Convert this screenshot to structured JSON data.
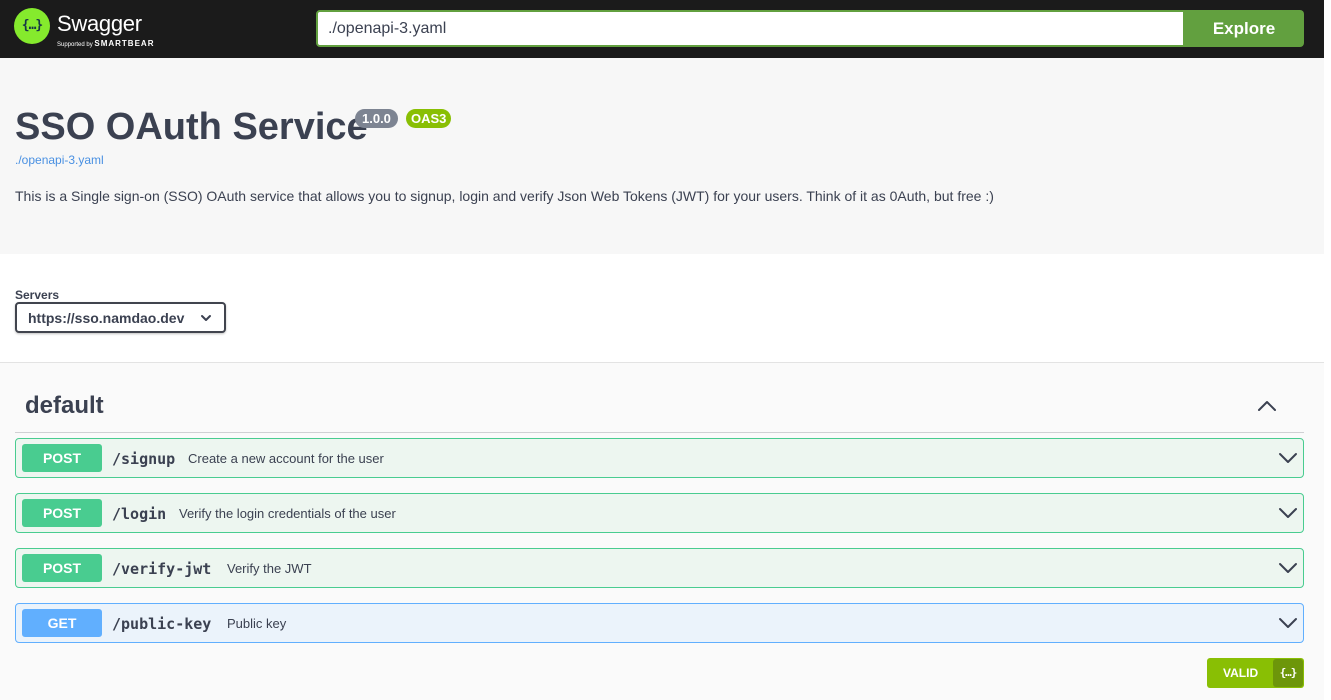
{
  "topbar": {
    "logo_glyph": "{…}",
    "logo_title": "Swagger",
    "logo_sub_prefix": "Supported by ",
    "logo_sub_brand": "SMARTBEAR",
    "spec_url_value": "./openapi-3.yaml",
    "explore_label": "Explore",
    "colors": {
      "background": "#1b1b1b",
      "accent": "#62a03f",
      "logo": "#85ea2d"
    }
  },
  "info": {
    "title": "SSO OAuth Service",
    "version": "1.0.0",
    "oas": "OAS3",
    "spec_link": "./openapi-3.yaml",
    "description": "This is a Single sign-on (SSO) OAuth service that allows you to signup, login and verify Json Web Tokens (JWT) for your users. Think of it as 0Auth, but free :)"
  },
  "servers": {
    "label": "Servers",
    "selected": "https://sso.namdao.dev"
  },
  "tag": {
    "name": "default",
    "operations": [
      {
        "method": "POST",
        "path": "/signup",
        "summary": "Create a new account for the user"
      },
      {
        "method": "POST",
        "path": "/login",
        "summary": "Verify the login credentials of the user"
      },
      {
        "method": "POST",
        "path": "/verify-jwt",
        "summary": "Verify the JWT"
      },
      {
        "method": "GET",
        "path": "/public-key",
        "summary": "Public key"
      }
    ]
  },
  "validator": {
    "label": "VALID",
    "icon_glyph": "{…}"
  },
  "colors": {
    "post": "#49cc90",
    "get": "#61affe",
    "valid": "#89bf04"
  },
  "icons": [
    "logo-icon",
    "chevron-down-icon",
    "chevron-up-icon",
    "validator-icon"
  ]
}
